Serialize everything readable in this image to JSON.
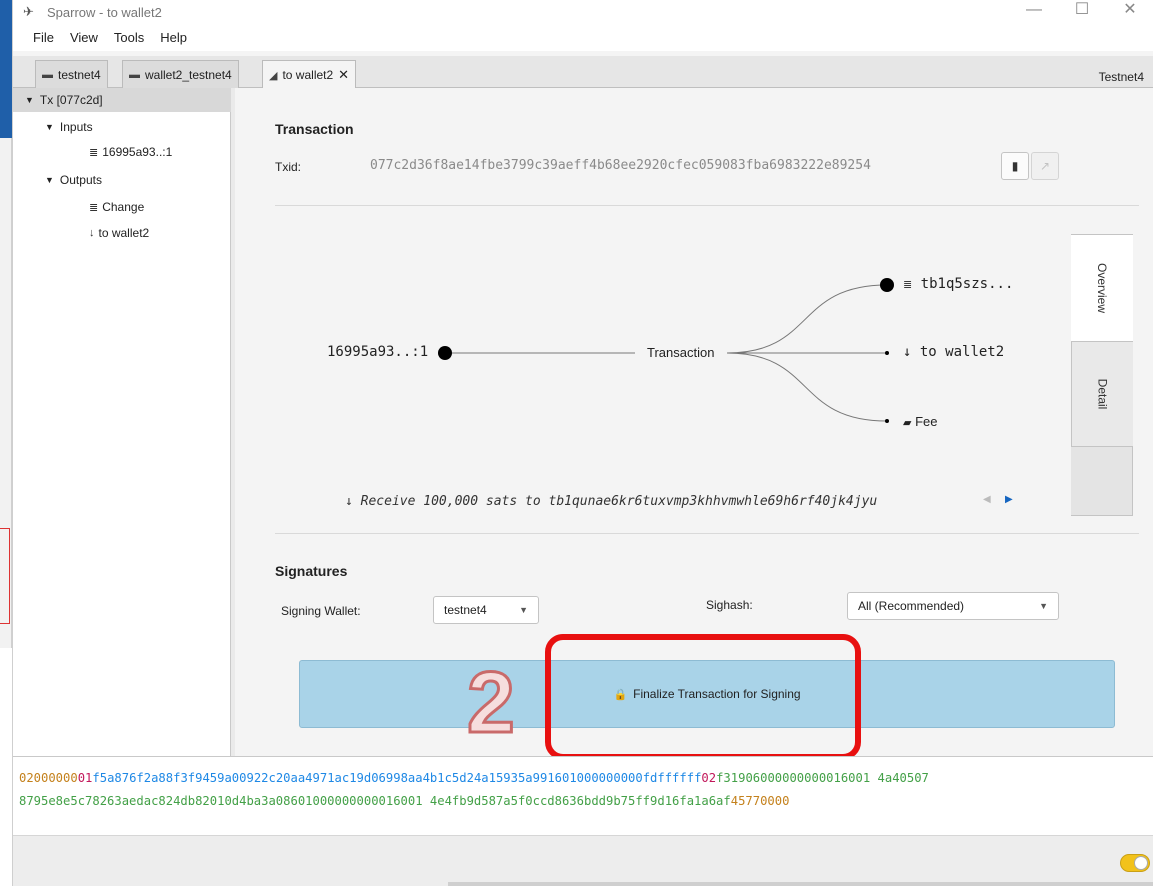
{
  "window": {
    "title": "Sparrow - to wallet2",
    "app_icon": "sparrow-logo-icon"
  },
  "menu": [
    "File",
    "View",
    "Tools",
    "Help"
  ],
  "tabs": [
    {
      "label": "testnet4",
      "icon": "wallet-icon"
    },
    {
      "label": "wallet2_testnet4",
      "icon": "wallet-icon"
    },
    {
      "label": "to wallet2",
      "icon": "send-icon",
      "close": "✕"
    }
  ],
  "network": "Testnet4",
  "tree": {
    "root": "Tx [077c2d]",
    "inputs_label": "Inputs",
    "input_item": "16995a93..:1",
    "outputs_label": "Outputs",
    "change_item": "Change",
    "wallet_item": "to wallet2"
  },
  "transaction": {
    "heading": "Transaction",
    "txid_label": "Txid:",
    "txid": "077c2d36f8ae14fbe3799c39aeff4b68ee2920cfec059083fba6983222e89254"
  },
  "diagram": {
    "input": "16995a93..:1",
    "center": "Transaction",
    "output_change": "tb1q5szs...",
    "output_payment": "to wallet2",
    "output_fee": "Fee",
    "receive_text": "Receive 100,000 sats to tb1qunae6kr6tuxvmp3khhvmwhle69h6rf40jk4jyu"
  },
  "side_tabs": {
    "overview": "Overview",
    "detail": "Detail"
  },
  "signatures": {
    "heading": "Signatures",
    "signing_wallet_label": "Signing Wallet:",
    "signing_wallet": "testnet4",
    "sighash_label": "Sighash:",
    "sighash": "All (Recommended)"
  },
  "finalize_label": "Finalize Transaction for Signing",
  "annotation_number": "2",
  "hex": {
    "line1": {
      "version": "02000000",
      "in_count": "01",
      "input": "f5a876f2a88f3f9459a00922c20aa4971ac19d06998aa4b1c5d24a15935a991601000000000fdffffff",
      "out_count": "02",
      "outputs": "f31906000000000016001 4a40507"
    },
    "line2": {
      "outputs": "8795e8e5c78263aedac824db82010d4ba3a08601000000000016001 4e4fb9d587a5f0ccd8636bdd9b75ff9d16fa1a6af",
      "locktime": "45770000"
    }
  },
  "colors": {
    "finalize_bg": "#a9d3e8",
    "annotation": "#e81010",
    "toggle": "#f2c21b"
  }
}
